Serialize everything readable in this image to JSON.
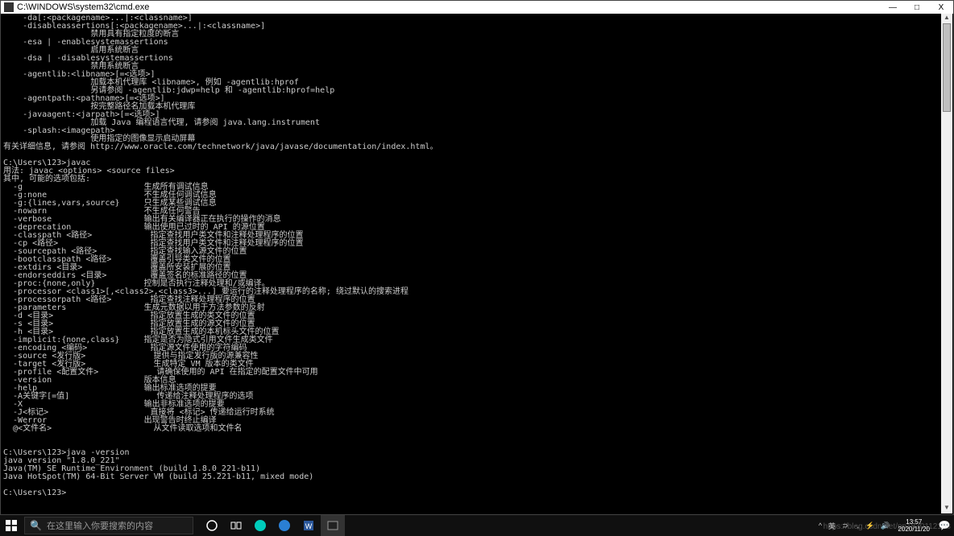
{
  "window": {
    "title": "C:\\WINDOWS\\system32\\cmd.exe",
    "controls": {
      "minimize": "—",
      "maximize": "□",
      "close": "X"
    }
  },
  "terminal_lines": [
    "    -da[:<packagename>...|:<classname>]",
    "    -disableassertions[:<packagename>...|:<classname>]",
    "                  禁用具有指定粒度的断言",
    "    -esa | -enablesystemassertions",
    "                  启用系统断言",
    "    -dsa | -disablesystemassertions",
    "                  禁用系统断言",
    "    -agentlib:<libname>[=<选项>]",
    "                  加载本机代理库 <libname>, 例如 -agentlib:hprof",
    "                  另请参阅 -agentlib:jdwp=help 和 -agentlib:hprof=help",
    "    -agentpath:<pathname>[=<选项>]",
    "                  按完整路径名加载本机代理库",
    "    -javaagent:<jarpath>[=<选项>]",
    "                  加载 Java 编程语言代理, 请参阅 java.lang.instrument",
    "    -splash:<imagepath>",
    "                  使用指定的图像显示启动屏幕",
    "有关详细信息, 请参阅 http://www.oracle.com/technetwork/java/javase/documentation/index.html。",
    "",
    "C:\\Users\\123>javac",
    "用法: javac <options> <source files>",
    "其中, 可能的选项包括:",
    "  -g                         生成所有调试信息",
    "  -g:none                    不生成任何调试信息",
    "  -g:{lines,vars,source}     只生成某些调试信息",
    "  -nowarn                    不生成任何警告",
    "  -verbose                   输出有关编译器正在执行的操作的消息",
    "  -deprecation               输出使用已过时的 API 的源位置",
    "  -classpath <路径>            指定查找用户类文件和注释处理程序的位置",
    "  -cp <路径>                   指定查找用户类文件和注释处理程序的位置",
    "  -sourcepath <路径>           指定查找输入源文件的位置",
    "  -bootclasspath <路径>        覆盖引导类文件的位置",
    "  -extdirs <目录>              覆盖所安装扩展的位置",
    "  -endorseddirs <目录>         覆盖签名的标准路径的位置",
    "  -proc:{none,only}          控制是否执行注释处理和/或编译。",
    "  -processor <class1>[,<class2>,<class3>...] 要运行的注释处理程序的名称; 绕过默认的搜索进程",
    "  -processorpath <路径>        指定查找注释处理程序的位置",
    "  -parameters                生成元数据以用于方法参数的反射",
    "  -d <目录>                    指定放置生成的类文件的位置",
    "  -s <目录>                    指定放置生成的源文件的位置",
    "  -h <目录>                    指定放置生成的本机标头文件的位置",
    "  -implicit:{none,class}     指定是否为隐式引用文件生成类文件",
    "  -encoding <编码>             指定源文件使用的字符编码",
    "  -source <发行版>              提供与指定发行版的源兼容性",
    "  -target <发行版>              生成特定 VM 版本的类文件",
    "  -profile <配置文件>            请确保使用的 API 在指定的配置文件中可用",
    "  -version                   版本信息",
    "  -help                      输出标准选项的提要",
    "  -A关键字[=值]                  传递给注释处理程序的选项",
    "  -X                         输出非标准选项的提要",
    "  -J<标记>                     直接将 <标记> 传递给运行时系统",
    "  -Werror                    出现警告时终止编译",
    "  @<文件名>                     从文件读取选项和文件名",
    "",
    "",
    "C:\\Users\\123>java -version",
    "java version \"1.8.0_221\"",
    "Java(TM) SE Runtime Environment (build 1.8.0_221-b11)",
    "Java HotSpot(TM) 64-Bit Server VM (build 25.221-b11, mixed mode)",
    "",
    "C:\\Users\\123>"
  ],
  "taskbar": {
    "search_placeholder": "在这里输入你要搜索的内容",
    "time": "13:57",
    "date": "2020/11/20",
    "watermark": "https://blog.csdn.net/pp1830112158"
  }
}
